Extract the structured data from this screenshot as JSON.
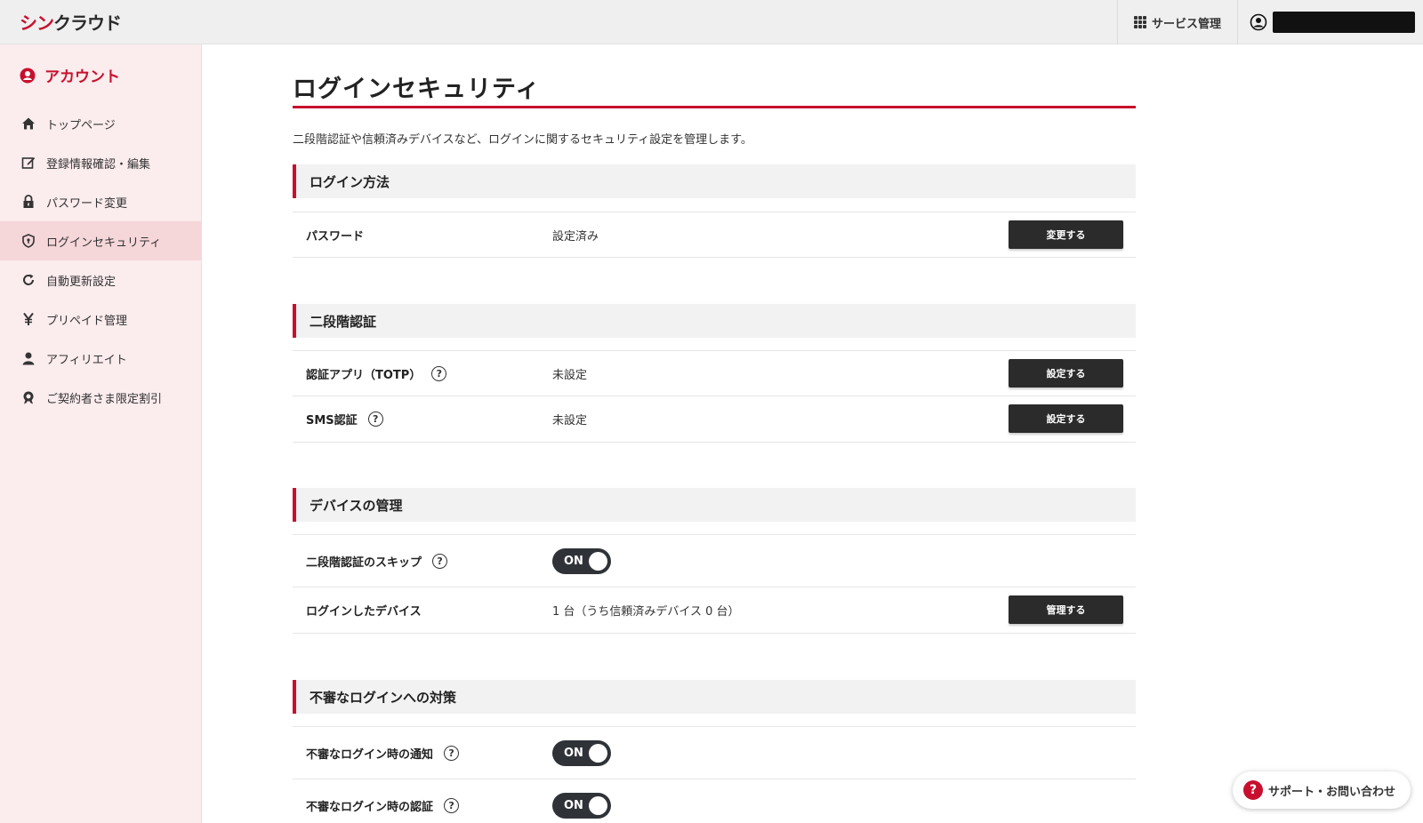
{
  "header": {
    "logo_part1": "シン",
    "logo_part2": "クラウド",
    "service_label": "サービス管理"
  },
  "sidebar": {
    "title": "アカウント",
    "items": [
      {
        "label": "トップページ"
      },
      {
        "label": "登録情報確認・編集"
      },
      {
        "label": "パスワード変更"
      },
      {
        "label": "ログインセキュリティ"
      },
      {
        "label": "自動更新設定"
      },
      {
        "label": "プリペイド管理"
      },
      {
        "label": "アフィリエイト"
      },
      {
        "label": "ご契約者さま限定割引"
      }
    ]
  },
  "main": {
    "title": "ログインセキュリティ",
    "description": "二段階認証や信頼済みデバイスなど、ログインに関するセキュリティ設定を管理します。",
    "sections": {
      "login_method": {
        "heading": "ログイン方法",
        "password_label": "パスワード",
        "password_value": "設定済み",
        "password_button": "変更する"
      },
      "two_factor": {
        "heading": "二段階認証",
        "totp_label": "認証アプリ（TOTP）",
        "totp_value": "未設定",
        "totp_button": "設定する",
        "sms_label": "SMS認証",
        "sms_value": "未設定",
        "sms_button": "設定する"
      },
      "devices": {
        "heading": "デバイスの管理",
        "skip_label": "二段階認証のスキップ",
        "skip_toggle": "ON",
        "logged_label": "ログインしたデバイス",
        "logged_value": "1 台（うち信頼済みデバイス 0 台）",
        "logged_button": "管理する"
      },
      "suspicious": {
        "heading": "不審なログインへの対策",
        "notify_label": "不審なログイン時の通知",
        "notify_toggle": "ON",
        "auth_label": "不審なログイン時の認証",
        "auth_toggle": "ON"
      }
    }
  },
  "support": {
    "label": "サポート・お問い合わせ"
  },
  "colors": {
    "accent": "#c8102e",
    "button": "#2b2b2b",
    "sidebar_bg": "#fbeced",
    "sidebar_active": "#f5d6d9"
  },
  "help_glyph": "?"
}
